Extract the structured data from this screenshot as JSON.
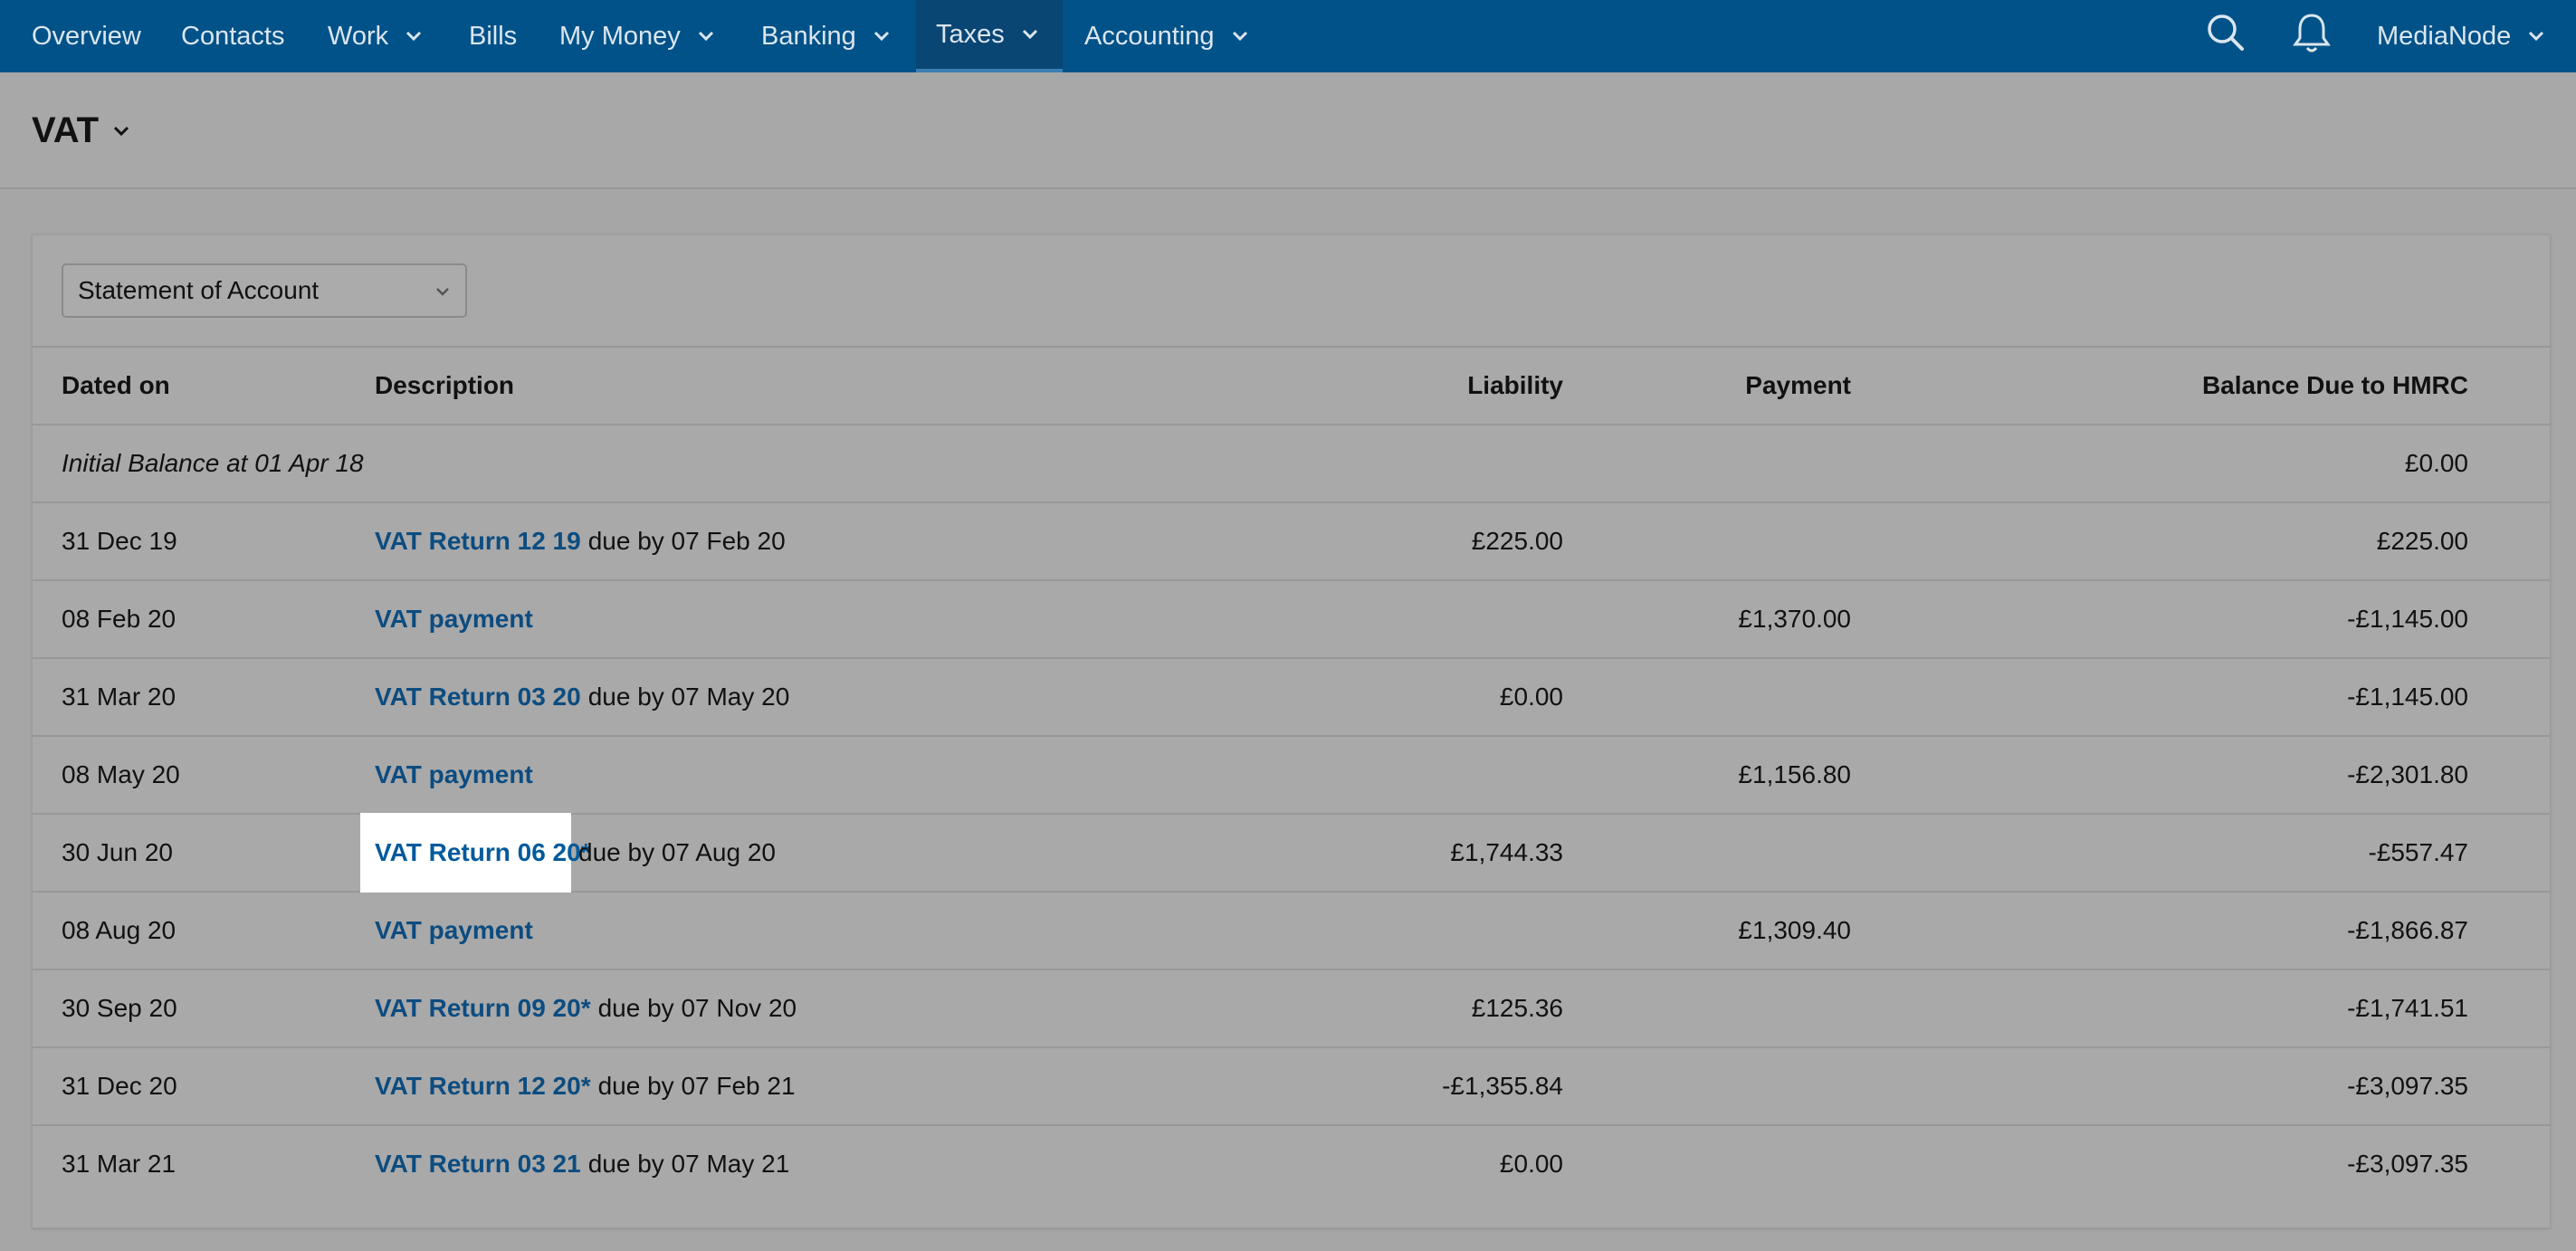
{
  "nav": {
    "items": [
      {
        "label": "Overview",
        "has_dropdown": false
      },
      {
        "label": "Contacts",
        "has_dropdown": false
      },
      {
        "label": "Work",
        "has_dropdown": true
      },
      {
        "label": "Bills",
        "has_dropdown": false
      },
      {
        "label": "My Money",
        "has_dropdown": true
      },
      {
        "label": "Banking",
        "has_dropdown": true
      },
      {
        "label": "Taxes",
        "has_dropdown": true,
        "active": true
      },
      {
        "label": "Accounting",
        "has_dropdown": true
      }
    ],
    "search_icon": "search-icon",
    "notifications_icon": "bell-icon",
    "account_label": "MediaNode"
  },
  "page": {
    "title": "VAT"
  },
  "statement_select": {
    "value": "Statement of Account"
  },
  "table": {
    "headers": {
      "date": "Dated on",
      "description": "Description",
      "liability": "Liability",
      "payment": "Payment",
      "balance": "Balance Due to HMRC"
    },
    "initial": {
      "label": "Initial Balance at 01 Apr 18",
      "balance": "£0.00"
    },
    "rows": [
      {
        "date": "31 Dec 19",
        "link": "VAT Return 12 19",
        "rest": "due by 07 Feb 20",
        "liability": "£225.00",
        "payment": "",
        "balance": "£225.00"
      },
      {
        "date": "08 Feb 20",
        "link": "VAT payment",
        "rest": "",
        "liability": "",
        "payment": "£1,370.00",
        "balance": "-£1,145.00"
      },
      {
        "date": "31 Mar 20",
        "link": "VAT Return 03 20",
        "rest": "due by 07 May 20",
        "liability": "£0.00",
        "payment": "",
        "balance": "-£1,145.00"
      },
      {
        "date": "08 May 20",
        "link": "VAT payment",
        "rest": "",
        "liability": "",
        "payment": "£1,156.80",
        "balance": "-£2,301.80"
      },
      {
        "date": "30 Jun 20",
        "link": "VAT Return 06 20*",
        "rest": "due by 07 Aug 20",
        "liability": "£1,744.33",
        "payment": "",
        "balance": "-£557.47",
        "highlighted": true
      },
      {
        "date": "08 Aug 20",
        "link": "VAT payment",
        "rest": "",
        "liability": "",
        "payment": "£1,309.40",
        "balance": "-£1,866.87"
      },
      {
        "date": "30 Sep 20",
        "link": "VAT Return 09 20*",
        "rest": "due by 07 Nov 20",
        "liability": "£125.36",
        "payment": "",
        "balance": "-£1,741.51"
      },
      {
        "date": "31 Dec 20",
        "link": "VAT Return 12 20*",
        "rest": "due by 07 Feb 21",
        "liability": "-£1,355.84",
        "payment": "",
        "balance": "-£3,097.35"
      },
      {
        "date": "31 Mar 21",
        "link": "VAT Return 03 21",
        "rest": "due by 07 May 21",
        "liability": "£0.00",
        "payment": "",
        "balance": "-£3,097.35"
      }
    ]
  },
  "colors": {
    "nav_bg": "#005288",
    "link": "#0c4c80",
    "page_bg": "#a6a6a6"
  }
}
